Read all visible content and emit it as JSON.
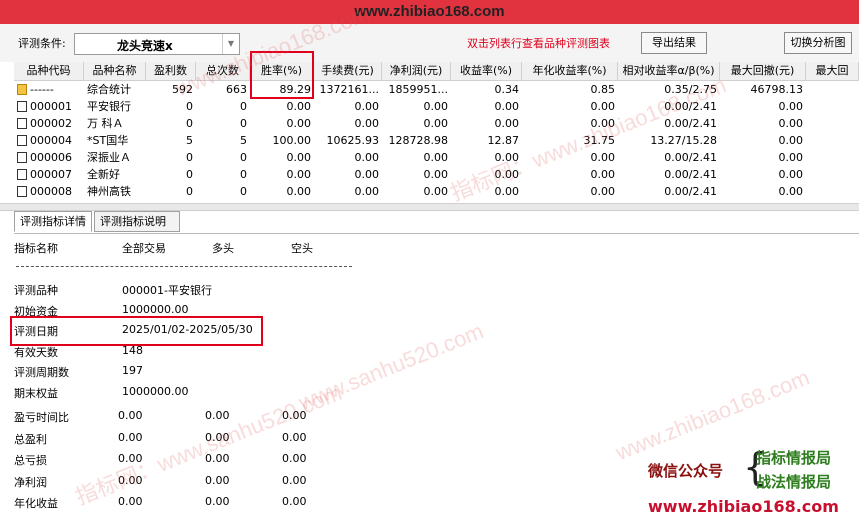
{
  "site_title": "www.zhibiao168.com",
  "toolbar": {
    "cond_label": "评测条件:",
    "select_value": "龙头竞速x",
    "hint": "双击列表行查看品种评测图表",
    "export_button": "导出结果",
    "switch_button": "切换分析图"
  },
  "columns": [
    "品种代码",
    "品种名称",
    "盈利数",
    "总次数",
    "胜率(%)",
    "手续费(元)",
    "净利润(元)",
    "收益率(%)",
    "年化收益率(%)",
    "相对收益率α/β(%)",
    "最大回撤(元)",
    "最大回"
  ],
  "rows": [
    {
      "code": "------",
      "name": "综合统计",
      "win": "592",
      "total": "663",
      "rate": "89.29",
      "fee": "1372161...",
      "profit": "1859951...",
      "ret": "0.34",
      "annual": "0.85",
      "alpha": "0.35/2.75",
      "dd": "46798.13",
      "icon": "folder"
    },
    {
      "code": "000001",
      "name": "平安银行",
      "win": "0",
      "total": "0",
      "rate": "0.00",
      "fee": "0.00",
      "profit": "0.00",
      "ret": "0.00",
      "annual": "0.00",
      "alpha": "0.00/2.41",
      "dd": "0.00",
      "icon": "doc"
    },
    {
      "code": "000002",
      "name": "万 科Ａ",
      "win": "0",
      "total": "0",
      "rate": "0.00",
      "fee": "0.00",
      "profit": "0.00",
      "ret": "0.00",
      "annual": "0.00",
      "alpha": "0.00/2.41",
      "dd": "0.00",
      "icon": "doc"
    },
    {
      "code": "000004",
      "name": "*ST国华",
      "win": "5",
      "total": "5",
      "rate": "100.00",
      "fee": "10625.93",
      "profit": "128728.98",
      "ret": "12.87",
      "annual": "31.75",
      "alpha": "13.27/15.28",
      "dd": "0.00",
      "icon": "doc"
    },
    {
      "code": "000006",
      "name": "深振业Ａ",
      "win": "0",
      "total": "0",
      "rate": "0.00",
      "fee": "0.00",
      "profit": "0.00",
      "ret": "0.00",
      "annual": "0.00",
      "alpha": "0.00/2.41",
      "dd": "0.00",
      "icon": "doc"
    },
    {
      "code": "000007",
      "name": "全新好",
      "win": "0",
      "total": "0",
      "rate": "0.00",
      "fee": "0.00",
      "profit": "0.00",
      "ret": "0.00",
      "annual": "0.00",
      "alpha": "0.00/2.41",
      "dd": "0.00",
      "icon": "doc"
    },
    {
      "code": "000008",
      "name": "神州高铁",
      "win": "0",
      "total": "0",
      "rate": "0.00",
      "fee": "0.00",
      "profit": "0.00",
      "ret": "0.00",
      "annual": "0.00",
      "alpha": "0.00/2.41",
      "dd": "0.00",
      "icon": "doc"
    }
  ],
  "tabs": [
    "评测指标详情",
    "评测指标说明"
  ],
  "report": {
    "headers": [
      "指标名称",
      "全部交易",
      "多头",
      "空头"
    ],
    "items": [
      {
        "label": "评测品种",
        "value": "000001-平安银行"
      },
      {
        "label": "初始资金",
        "value": "1000000.00"
      },
      {
        "label": "评测日期",
        "value": "2025/01/02-2025/05/30"
      },
      {
        "label": "有效天数",
        "value": "148"
      },
      {
        "label": "评测周期数",
        "value": "197"
      },
      {
        "label": "期末权益",
        "value": "1000000.00"
      }
    ],
    "metrics": [
      {
        "label": "盈亏时间比",
        "all": "0.00",
        "long": "0.00",
        "short": "0.00"
      },
      {
        "label": "总盈利",
        "all": "0.00",
        "long": "0.00",
        "short": "0.00"
      },
      {
        "label": "总亏损",
        "all": "0.00",
        "long": "0.00",
        "short": "0.00"
      },
      {
        "label": "净利润",
        "all": "0.00",
        "long": "0.00",
        "short": "0.00"
      },
      {
        "label": "年化收益",
        "all": "0.00",
        "long": "0.00",
        "short": "0.00"
      }
    ]
  },
  "promo": {
    "label": "微信公众号",
    "line1": "指标情报局",
    "line2": "战法情报局",
    "url": "www.zhibiao168.com"
  },
  "watermarks": [
    "www.zhibiao168.com",
    "www.sanhu520.com",
    "指标网：www.sanhu520.com",
    "指标网：www.zhibiao168.com"
  ],
  "colors": {
    "title_bar": "#e0323f",
    "highlight_box": "#e0001c",
    "hint_text": "#e0001c"
  }
}
